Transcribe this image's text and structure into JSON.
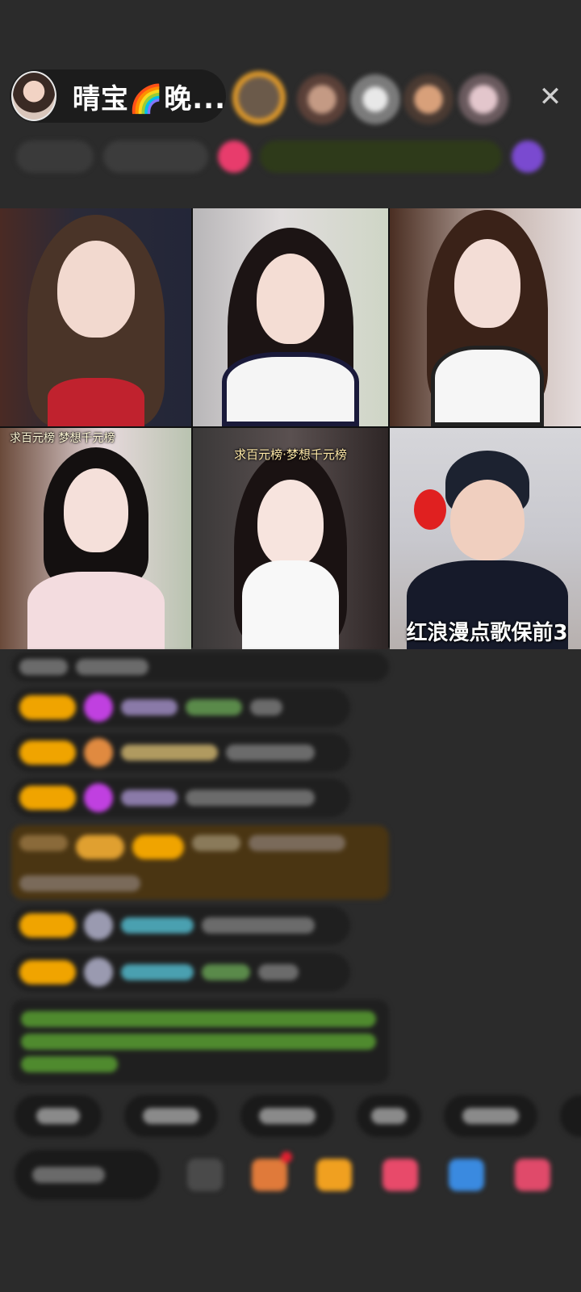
{
  "header": {
    "host_name": "晴宝🌈晚...",
    "close_label": "✕"
  },
  "tiles": [
    {
      "caption": ""
    },
    {
      "caption": ""
    },
    {
      "caption": ""
    },
    {
      "caption": "求百元榜 梦想千元榜"
    },
    {
      "caption": "求百元榜·梦想千元榜"
    },
    {
      "caption": "红浪漫点歌保前3"
    }
  ],
  "colors": {
    "background": "#2b2b2b",
    "badge": "#f0a400",
    "gift_highlight": "#4a3512",
    "system_text": "#6dbf3a"
  }
}
